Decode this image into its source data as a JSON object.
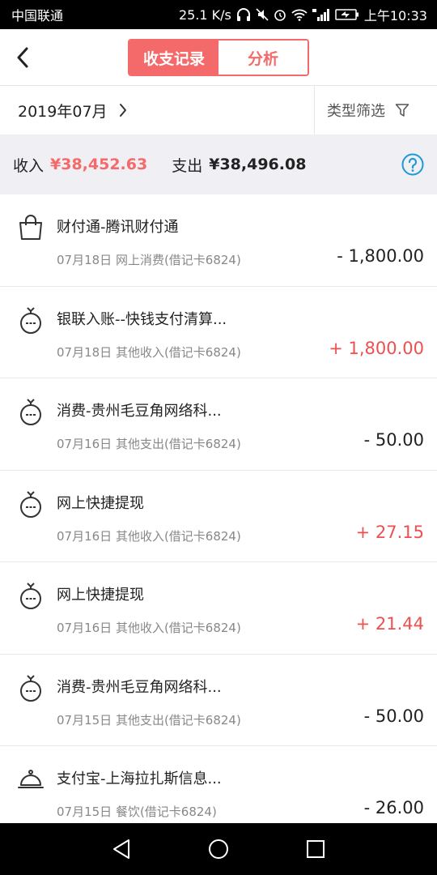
{
  "status": {
    "carrier": "中国联通",
    "speed": "25.1 K/s",
    "time": "上午10:33"
  },
  "header": {
    "tabs": [
      {
        "label": "收支记录",
        "active": true
      },
      {
        "label": "分析",
        "active": false
      }
    ],
    "accent_color": "#f46a6a"
  },
  "filter": {
    "month": "2019年07月",
    "type_filter": "类型筛选"
  },
  "summary": {
    "income_label": "收入",
    "income_value": "¥38,452.63",
    "expense_label": "支出",
    "expense_value": "¥38,496.08"
  },
  "transactions": [
    {
      "icon": "shopping-bag-icon",
      "title": "财付通-腾讯财付通",
      "subtitle": "07月18日 网上消费(借记卡6824)",
      "amount": "- 1,800.00",
      "sign": "neg"
    },
    {
      "icon": "money-bag-icon",
      "title": "银联入账--快钱支付清算...",
      "subtitle": "07月18日 其他收入(借记卡6824)",
      "amount": "+ 1,800.00",
      "sign": "pos"
    },
    {
      "icon": "money-bag-icon",
      "title": "消费-贵州毛豆角网络科...",
      "subtitle": "07月16日 其他支出(借记卡6824)",
      "amount": "- 50.00",
      "sign": "neg"
    },
    {
      "icon": "money-bag-icon",
      "title": "网上快捷提现",
      "subtitle": "07月16日 其他收入(借记卡6824)",
      "amount": "+ 27.15",
      "sign": "pos"
    },
    {
      "icon": "money-bag-icon",
      "title": "网上快捷提现",
      "subtitle": "07月16日 其他收入(借记卡6824)",
      "amount": "+ 21.44",
      "sign": "pos"
    },
    {
      "icon": "money-bag-icon",
      "title": "消费-贵州毛豆角网络科...",
      "subtitle": "07月15日 其他支出(借记卡6824)",
      "amount": "- 50.00",
      "sign": "neg"
    },
    {
      "icon": "food-cloche-icon",
      "title": "支付宝-上海拉扎斯信息...",
      "subtitle": "07月15日 餐饮(借记卡6824)",
      "amount": "- 26.00",
      "sign": "neg"
    }
  ]
}
